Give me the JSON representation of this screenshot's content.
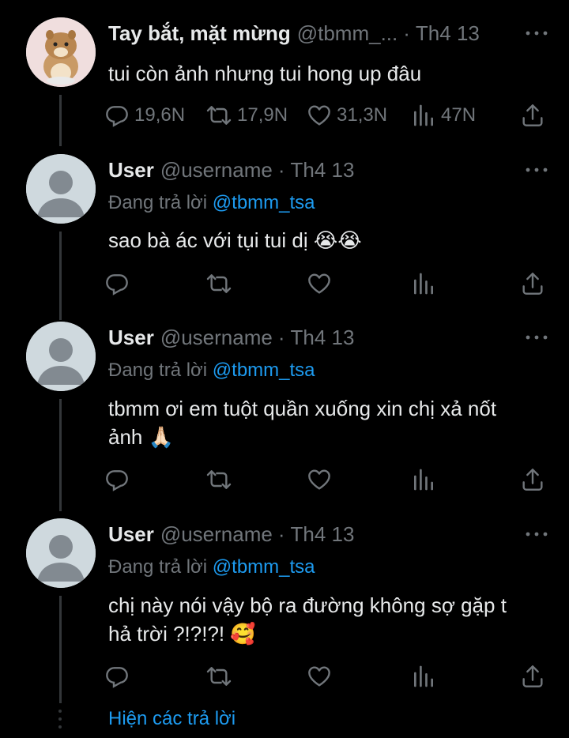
{
  "original": {
    "name": "Tay bắt, mặt mừng",
    "handle": "@tbmm_...",
    "dot": "·",
    "date": "Th4 13",
    "text": "tui còn ảnh nhưng tui hong up đâu",
    "replies": "19,6N",
    "retweets": "17,9N",
    "likes": "31,3N",
    "views": "47N"
  },
  "replies": [
    {
      "name": "User",
      "handle": "@username",
      "dot": "·",
      "date": "Th4 13",
      "replying_prefix": "Đang trả lời",
      "replying_to": "@tbmm_tsa",
      "text_line1": "sao bà ác với tụi tui dị 😭😭",
      "text_line2": ""
    },
    {
      "name": "User",
      "handle": "@username",
      "dot": "·",
      "date": "Th4 13",
      "replying_prefix": "Đang trả lời",
      "replying_to": "@tbmm_tsa",
      "text_line1": "tbmm ơi em tuột quần xuống xin chị xả nốt",
      "text_line2": "ảnh 🙏🏻"
    },
    {
      "name": "User",
      "handle": "@username",
      "dot": "·",
      "date": "Th4 13",
      "replying_prefix": "Đang trả lời",
      "replying_to": "@tbmm_tsa",
      "text_line1": "chị này nói vậy bộ ra đường không sợ gặp t",
      "text_line2": "hả trời ?!?!?! 🥰"
    }
  ],
  "show_replies_label": "Hiện các trả lời",
  "icons": {
    "reply": "reply-icon",
    "retweet": "retweet-icon",
    "like": "heart-icon",
    "views": "views-icon",
    "share": "share-icon",
    "more": "more-icon"
  },
  "colors": {
    "background": "#000000",
    "text": "#e7e9ea",
    "secondary": "#71767b",
    "accent": "#1d9bf0"
  }
}
